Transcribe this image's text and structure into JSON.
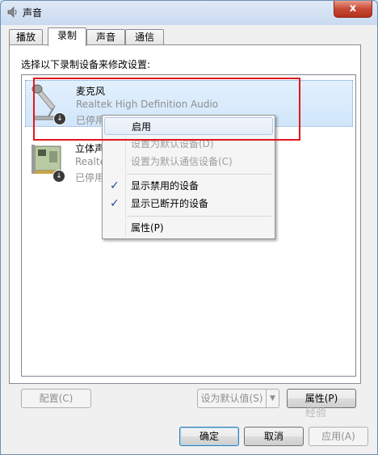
{
  "window": {
    "title": "声音",
    "close_label": "x"
  },
  "tabs": [
    {
      "label": "播放"
    },
    {
      "label": "录制"
    },
    {
      "label": "声音"
    },
    {
      "label": "通信"
    }
  ],
  "panel": {
    "instruction": "选择以下录制设备来修改设置:"
  },
  "devices": [
    {
      "name": "麦克风",
      "description": "Realtek High Definition Audio",
      "status": "已停用",
      "icon": "microphone-icon"
    },
    {
      "name": "立体声",
      "description": "Realte",
      "status": "已停用",
      "icon": "sound-card-icon"
    }
  ],
  "context_menu": {
    "enable": "启用",
    "set_default": "设置为默认设备(D)",
    "set_default_comm": "设置为默认通信设备(C)",
    "show_disabled": "显示禁用的设备",
    "show_disconnected": "显示已断开的设备",
    "properties": "属性(P)",
    "check_glyph": "✓"
  },
  "buttons": {
    "configure": "配置(C)",
    "set_default": "设为默认值(S)",
    "properties": "属性(P)",
    "ok": "确定",
    "cancel": "取消",
    "apply": "应用(A)"
  },
  "watermark": "经验",
  "colors": {
    "highlight": "#e0171f",
    "accent": "#1c4a9c"
  }
}
